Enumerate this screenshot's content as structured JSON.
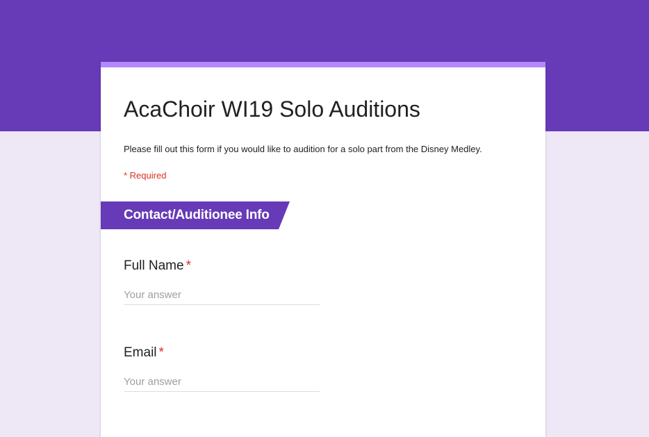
{
  "theme": {
    "accent": "#673ab7",
    "accent_light": "#b388ff",
    "background": "#ede7f6",
    "required": "#d93025"
  },
  "form": {
    "title": "AcaChoir WI19 Solo Auditions",
    "description": "Please fill out this form if you would like to audition for a solo part from the Disney Medley.",
    "required_note": "* Required"
  },
  "section": {
    "title": "Contact/Auditionee Info"
  },
  "questions": [
    {
      "label": "Full Name",
      "required_mark": "*",
      "placeholder": "Your answer",
      "value": ""
    },
    {
      "label": "Email",
      "required_mark": "*",
      "placeholder": "Your answer",
      "value": ""
    }
  ]
}
